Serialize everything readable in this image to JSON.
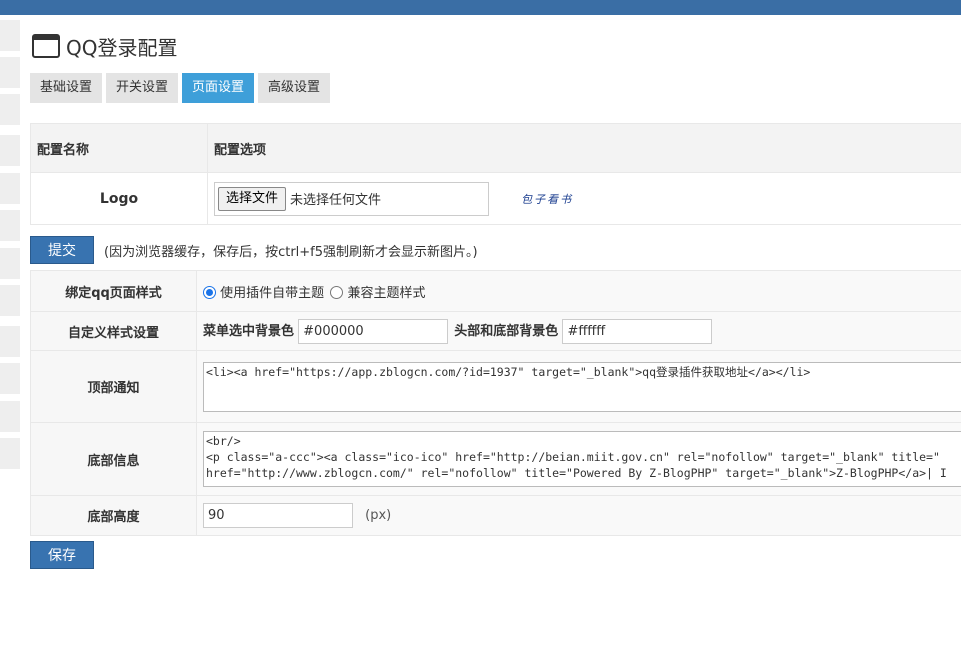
{
  "page": {
    "title": "QQ登录配置"
  },
  "tabs": [
    "基础设置",
    "开关设置",
    "页面设置",
    "高级设置"
  ],
  "active_tab": "页面设置",
  "logo_table": {
    "header_name": "配置名称",
    "header_option": "配置选项",
    "logo_label": "Logo",
    "file_button": "选择文件",
    "file_status": "未选择任何文件",
    "logo_text": "包子看书"
  },
  "submit": {
    "label": "提交",
    "hint": "(因为浏览器缓存，保存后，按ctrl+f5强制刷新才会显示新图片。)"
  },
  "settings": {
    "bind_style": {
      "label": "绑定qq页面样式",
      "option1": "使用插件自带主题",
      "option2": "兼容主题样式",
      "selected": "使用插件自带主题"
    },
    "custom_style": {
      "label": "自定义样式设置",
      "menu_bg_label": "菜单选中背景色",
      "menu_bg_value": "#000000",
      "header_bg_label": "头部和底部背景色",
      "header_bg_value": "#ffffff"
    },
    "top_notice": {
      "label": "顶部通知",
      "value": "<li><a href=\"https://app.zblogcn.com/?id=1937\" target=\"_blank\">qq登录插件获取地址</a></li>"
    },
    "footer_info": {
      "label": "底部信息",
      "value": "<br/>\n<p class=\"a-ccc\"><a class=\"ico-ico\" href=\"http://beian.miit.gov.cn\" rel=\"nofollow\" target=\"_blank\" title=\"\nhref=\"http://www.zblogcn.com/\" rel=\"nofollow\" title=\"Powered By Z-BlogPHP\" target=\"_blank\">Z-BlogPHP</a>| I"
    },
    "footer_height": {
      "label": "底部高度",
      "value": "90",
      "unit": "(px)"
    }
  },
  "save": {
    "label": "保存"
  },
  "colors": {
    "topbar": "#3a6ea5",
    "active_tab": "#3e9fd9",
    "primary_button": "#3873b0"
  },
  "icons": {
    "title_icon": "window-icon",
    "radio_checked": "radio-checked-icon",
    "radio_unchecked": "radio-unchecked-icon"
  }
}
